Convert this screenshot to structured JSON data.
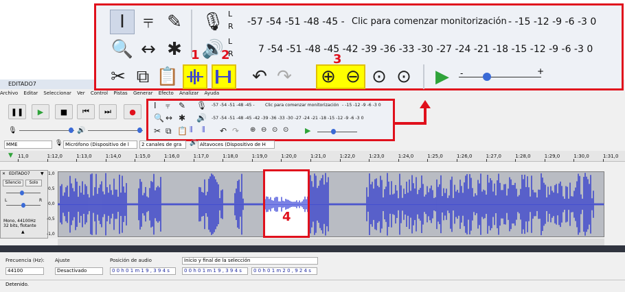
{
  "window": {
    "title": "EDITADO7"
  },
  "menu": [
    "Archivo",
    "Editar",
    "Seleccionar",
    "Ver",
    "Control",
    "Pistas",
    "Generar",
    "Efecto",
    "Analizar",
    "Ayuda"
  ],
  "meters": {
    "record_scale": "-57 -54 -51 -48 -45 -",
    "record_monitor_text": "Clic para comenzar monitorización",
    "record_scale_right": "- -15 -12  -9   -6   -3   0",
    "playback_scale": "7 -54 -51 -48 -45 -42 -39 -36 -33 -30 -27 -24 -21 -18 -15 -12  -9   -6   -3   0",
    "L": "L",
    "R": "R"
  },
  "mini_meters": {
    "record_scale": "-57 -54 -51 -48 -45 -",
    "record_monitor_text": "Clic para comenzar monitorización",
    "record_scale_right": "- -15 -12 -9 -6 -3 0",
    "playback_scale": "-57 -54 -51 -48 -45 -42 -39 -36 -33 -30 -27 -24 -21 -18 -15 -12 -9 -6 -3 0"
  },
  "callouts": [
    "1",
    "2",
    "3",
    "4"
  ],
  "devices": {
    "host": "MME",
    "input": "Micrófono (Dispositivo de l",
    "channels": "2 canales de gra",
    "output": "Altavoces (Dispositivo de H"
  },
  "ruler": {
    "labels": [
      "1:11,0",
      "1:12,0",
      "1:13,0",
      "1:14,0",
      "1:15,0",
      "1:16,0",
      "1:17,0",
      "1:18,0",
      "1:19,0",
      "1:20,0",
      "1:21,0",
      "1:22,0",
      "1:23,0",
      "1:24,0",
      "1:25,0",
      "1:26,0",
      "1:27,0",
      "1:28,0",
      "1:29,0",
      "1:30,0",
      "1:31,0"
    ],
    "first_label": "11,0"
  },
  "track": {
    "name": "EDITADO7",
    "mute": "Silencio",
    "solo": "Solo",
    "info_line1": "Mono, 44100Hz",
    "info_line2": "32 bits, flotante",
    "scale": [
      "1,0",
      "0,5",
      "0,0",
      "-0,5",
      "-1,0"
    ],
    "gain_left": "L",
    "gain_right": "R"
  },
  "bottom": {
    "rate_label": "Frecuencia (Hz):",
    "rate_value": "44100",
    "snap_label": "Ajuste",
    "snap_value": "Desactivado",
    "position_label": "Posición de audio",
    "position_value": "0 0 h 0 1 m 1 9 , 3 9 4 s",
    "selection_mode": "Inicio y final de la selección",
    "selection_start": "0 0 h 0 1 m 1 9 , 3 9 4 s",
    "selection_end": "0 0 h 0 1 m 2 0 , 9 2 4 s"
  },
  "status": "Detenido.",
  "colors": {
    "callout_red": "#e0101c",
    "highlight_yellow": "#ffff00",
    "wave_blue": "#3f48cc",
    "play_green": "#2fa33a"
  }
}
